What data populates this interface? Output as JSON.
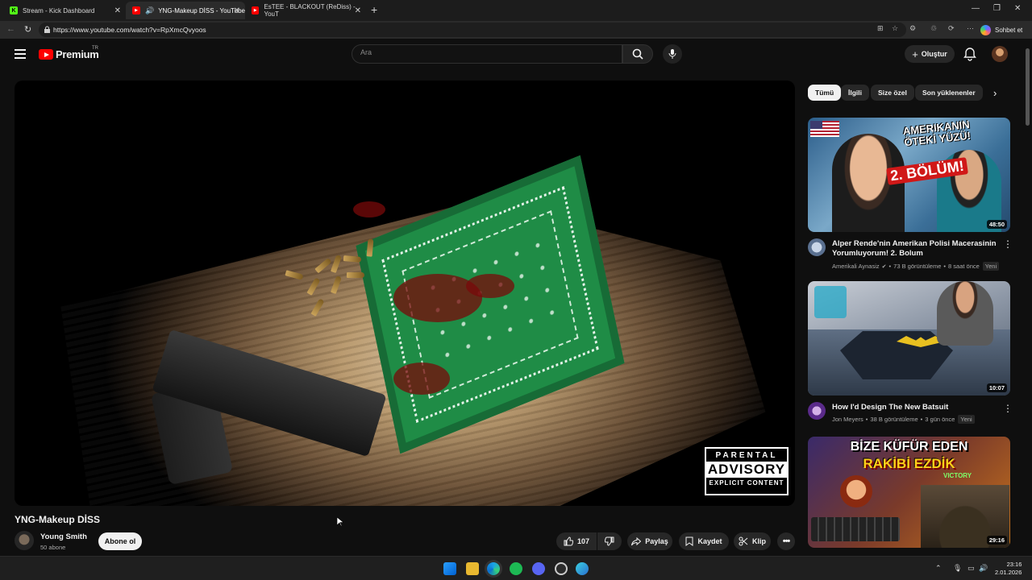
{
  "browser": {
    "tabs": [
      {
        "title": "Stream - Kick Dashboard",
        "fav_color": "#53fc18",
        "fav_glyph": "K"
      },
      {
        "title": "YNG-Makeup DİSS - YouTube",
        "fav_color": "#ff0000",
        "fav_glyph": "▶"
      },
      {
        "title": "EsTEE - BLACKOUT (ReDiss) - YouT",
        "fav_color": "#ff0000",
        "fav_glyph": "▶"
      }
    ],
    "url": "https://www.youtube.com/watch?v=RpXmcQvyoos",
    "copilot_label": "Sohbet et"
  },
  "youtube": {
    "logo_word": "Premium",
    "region": "TR",
    "search_placeholder": "Ara",
    "create_label": "Oluştur"
  },
  "video": {
    "title": "YNG-Makeup DİSS",
    "channel": "Young Smith",
    "subscribers": "50 abone",
    "subscribe_label": "Abone ol",
    "likes": "107",
    "share_label": "Paylaş",
    "save_label": "Kaydet",
    "clip_label": "Klip",
    "advisory": {
      "line1": "PARENTAL",
      "line2": "ADVISORY",
      "line3": "EXPLICIT CONTENT"
    }
  },
  "chips": [
    "Tümü",
    "İlgili",
    "Size özel",
    "Son yüklenenler"
  ],
  "recommendations": [
    {
      "title": "Alper Rende'nin Amerikan Polisi Macerasinin Yorumluyorum! 2. Bolum",
      "channel": "Amerikali Aynasiz",
      "views": "73 B görüntüleme",
      "age": "8 saat önce",
      "badge": "Yeni",
      "duration": "48:50",
      "thumb_text1": "AMERIKANIN ÖTEKİ YÜZÜ!",
      "thumb_text2": "2. BÖLÜM!"
    },
    {
      "title": "How I'd Design The New Batsuit",
      "channel": "Jon Meyers",
      "views": "38 B görüntüleme",
      "age": "3 gün önce",
      "badge": "Yeni",
      "duration": "10:07"
    },
    {
      "duration": "29:16",
      "thumb_text1": "BİZE KÜFÜR EDEN",
      "thumb_text2": "RAKİBİ EZDİK",
      "thumb_text3": "VICTORY"
    }
  ],
  "taskbar": {
    "time": "23:16",
    "date": "2.01.2026"
  }
}
